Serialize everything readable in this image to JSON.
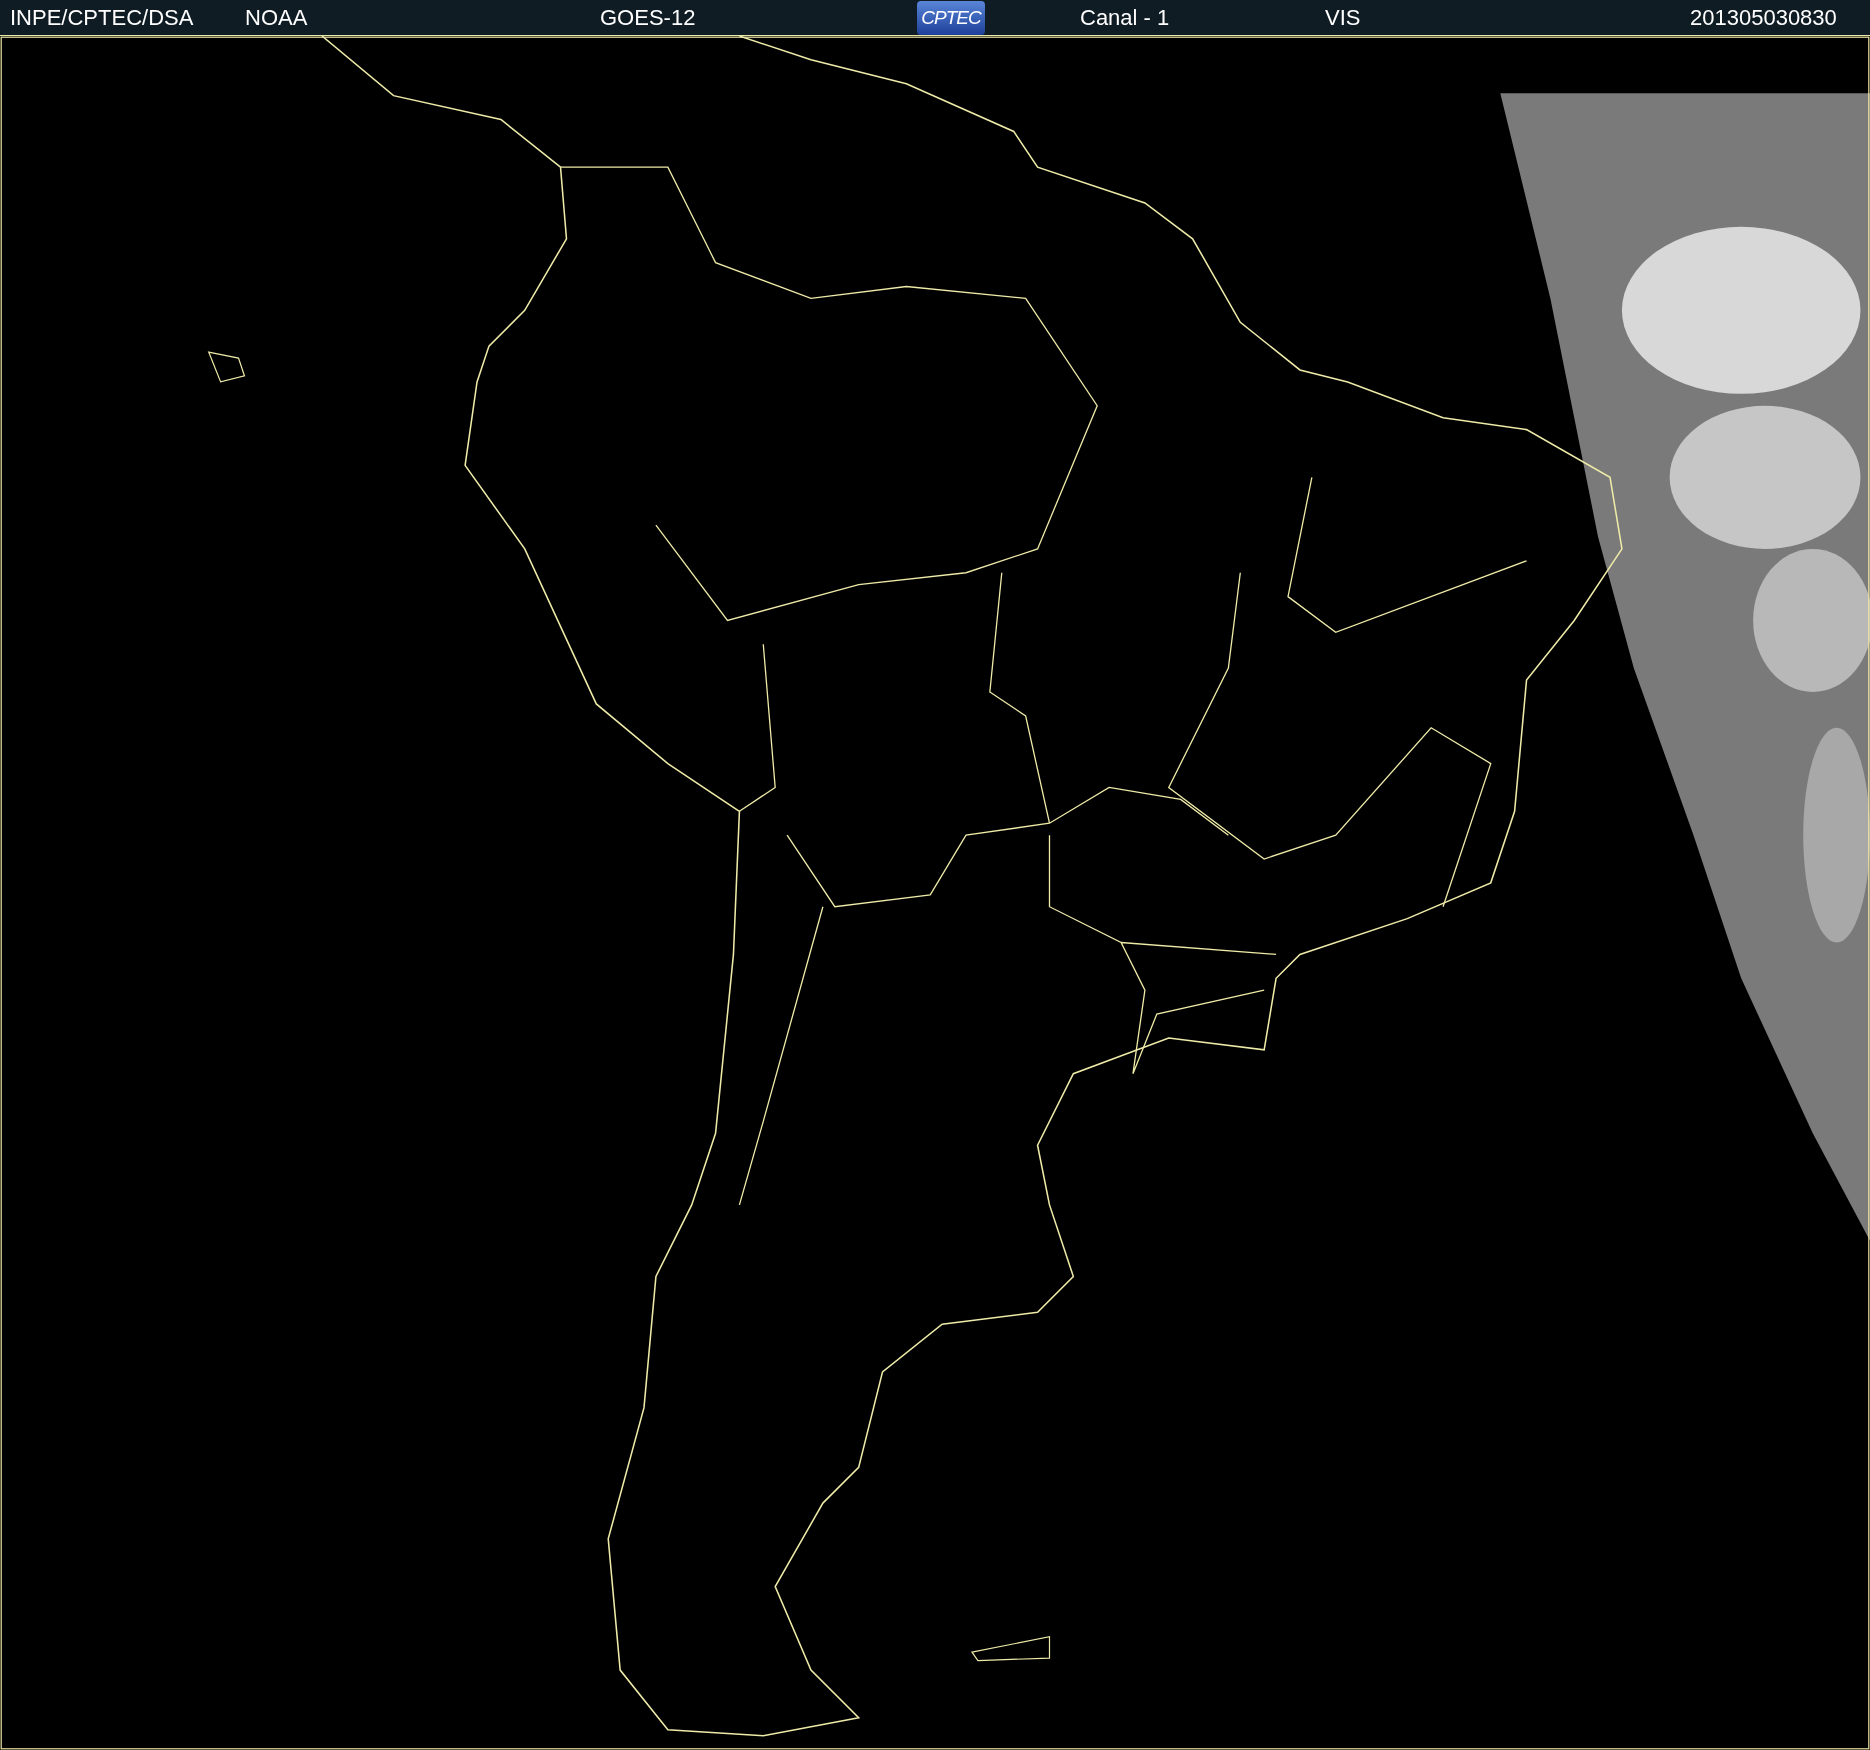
{
  "header": {
    "items": [
      {
        "kind": "text",
        "text": "INPE/CPTEC/DSA"
      },
      {
        "kind": "text",
        "text": "NOAA"
      },
      {
        "kind": "text",
        "text": "GOES-12"
      },
      {
        "kind": "logo",
        "text": "CPTEC"
      },
      {
        "kind": "text",
        "text": "Canal - 1"
      },
      {
        "kind": "text",
        "text": "VIS"
      },
      {
        "kind": "text",
        "text": "201305030830"
      }
    ]
  }
}
